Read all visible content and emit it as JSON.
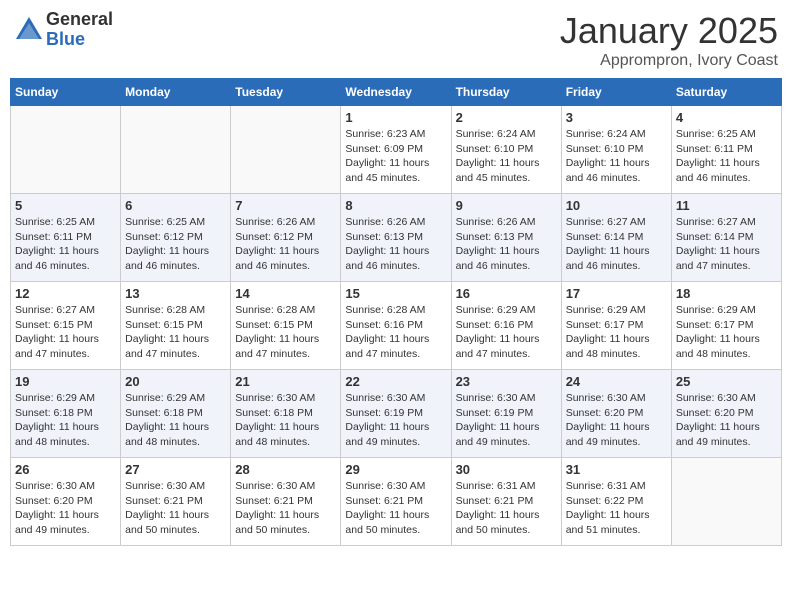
{
  "logo": {
    "general": "General",
    "blue": "Blue"
  },
  "title": "January 2025",
  "subtitle": "Apprompron, Ivory Coast",
  "days_of_week": [
    "Sunday",
    "Monday",
    "Tuesday",
    "Wednesday",
    "Thursday",
    "Friday",
    "Saturday"
  ],
  "weeks": [
    [
      {
        "day": "",
        "info": ""
      },
      {
        "day": "",
        "info": ""
      },
      {
        "day": "",
        "info": ""
      },
      {
        "day": "1",
        "info": "Sunrise: 6:23 AM\nSunset: 6:09 PM\nDaylight: 11 hours and 45 minutes."
      },
      {
        "day": "2",
        "info": "Sunrise: 6:24 AM\nSunset: 6:10 PM\nDaylight: 11 hours and 45 minutes."
      },
      {
        "day": "3",
        "info": "Sunrise: 6:24 AM\nSunset: 6:10 PM\nDaylight: 11 hours and 46 minutes."
      },
      {
        "day": "4",
        "info": "Sunrise: 6:25 AM\nSunset: 6:11 PM\nDaylight: 11 hours and 46 minutes."
      }
    ],
    [
      {
        "day": "5",
        "info": "Sunrise: 6:25 AM\nSunset: 6:11 PM\nDaylight: 11 hours and 46 minutes."
      },
      {
        "day": "6",
        "info": "Sunrise: 6:25 AM\nSunset: 6:12 PM\nDaylight: 11 hours and 46 minutes."
      },
      {
        "day": "7",
        "info": "Sunrise: 6:26 AM\nSunset: 6:12 PM\nDaylight: 11 hours and 46 minutes."
      },
      {
        "day": "8",
        "info": "Sunrise: 6:26 AM\nSunset: 6:13 PM\nDaylight: 11 hours and 46 minutes."
      },
      {
        "day": "9",
        "info": "Sunrise: 6:26 AM\nSunset: 6:13 PM\nDaylight: 11 hours and 46 minutes."
      },
      {
        "day": "10",
        "info": "Sunrise: 6:27 AM\nSunset: 6:14 PM\nDaylight: 11 hours and 46 minutes."
      },
      {
        "day": "11",
        "info": "Sunrise: 6:27 AM\nSunset: 6:14 PM\nDaylight: 11 hours and 47 minutes."
      }
    ],
    [
      {
        "day": "12",
        "info": "Sunrise: 6:27 AM\nSunset: 6:15 PM\nDaylight: 11 hours and 47 minutes."
      },
      {
        "day": "13",
        "info": "Sunrise: 6:28 AM\nSunset: 6:15 PM\nDaylight: 11 hours and 47 minutes."
      },
      {
        "day": "14",
        "info": "Sunrise: 6:28 AM\nSunset: 6:15 PM\nDaylight: 11 hours and 47 minutes."
      },
      {
        "day": "15",
        "info": "Sunrise: 6:28 AM\nSunset: 6:16 PM\nDaylight: 11 hours and 47 minutes."
      },
      {
        "day": "16",
        "info": "Sunrise: 6:29 AM\nSunset: 6:16 PM\nDaylight: 11 hours and 47 minutes."
      },
      {
        "day": "17",
        "info": "Sunrise: 6:29 AM\nSunset: 6:17 PM\nDaylight: 11 hours and 48 minutes."
      },
      {
        "day": "18",
        "info": "Sunrise: 6:29 AM\nSunset: 6:17 PM\nDaylight: 11 hours and 48 minutes."
      }
    ],
    [
      {
        "day": "19",
        "info": "Sunrise: 6:29 AM\nSunset: 6:18 PM\nDaylight: 11 hours and 48 minutes."
      },
      {
        "day": "20",
        "info": "Sunrise: 6:29 AM\nSunset: 6:18 PM\nDaylight: 11 hours and 48 minutes."
      },
      {
        "day": "21",
        "info": "Sunrise: 6:30 AM\nSunset: 6:18 PM\nDaylight: 11 hours and 48 minutes."
      },
      {
        "day": "22",
        "info": "Sunrise: 6:30 AM\nSunset: 6:19 PM\nDaylight: 11 hours and 49 minutes."
      },
      {
        "day": "23",
        "info": "Sunrise: 6:30 AM\nSunset: 6:19 PM\nDaylight: 11 hours and 49 minutes."
      },
      {
        "day": "24",
        "info": "Sunrise: 6:30 AM\nSunset: 6:20 PM\nDaylight: 11 hours and 49 minutes."
      },
      {
        "day": "25",
        "info": "Sunrise: 6:30 AM\nSunset: 6:20 PM\nDaylight: 11 hours and 49 minutes."
      }
    ],
    [
      {
        "day": "26",
        "info": "Sunrise: 6:30 AM\nSunset: 6:20 PM\nDaylight: 11 hours and 49 minutes."
      },
      {
        "day": "27",
        "info": "Sunrise: 6:30 AM\nSunset: 6:21 PM\nDaylight: 11 hours and 50 minutes."
      },
      {
        "day": "28",
        "info": "Sunrise: 6:30 AM\nSunset: 6:21 PM\nDaylight: 11 hours and 50 minutes."
      },
      {
        "day": "29",
        "info": "Sunrise: 6:30 AM\nSunset: 6:21 PM\nDaylight: 11 hours and 50 minutes."
      },
      {
        "day": "30",
        "info": "Sunrise: 6:31 AM\nSunset: 6:21 PM\nDaylight: 11 hours and 50 minutes."
      },
      {
        "day": "31",
        "info": "Sunrise: 6:31 AM\nSunset: 6:22 PM\nDaylight: 11 hours and 51 minutes."
      },
      {
        "day": "",
        "info": ""
      }
    ]
  ]
}
